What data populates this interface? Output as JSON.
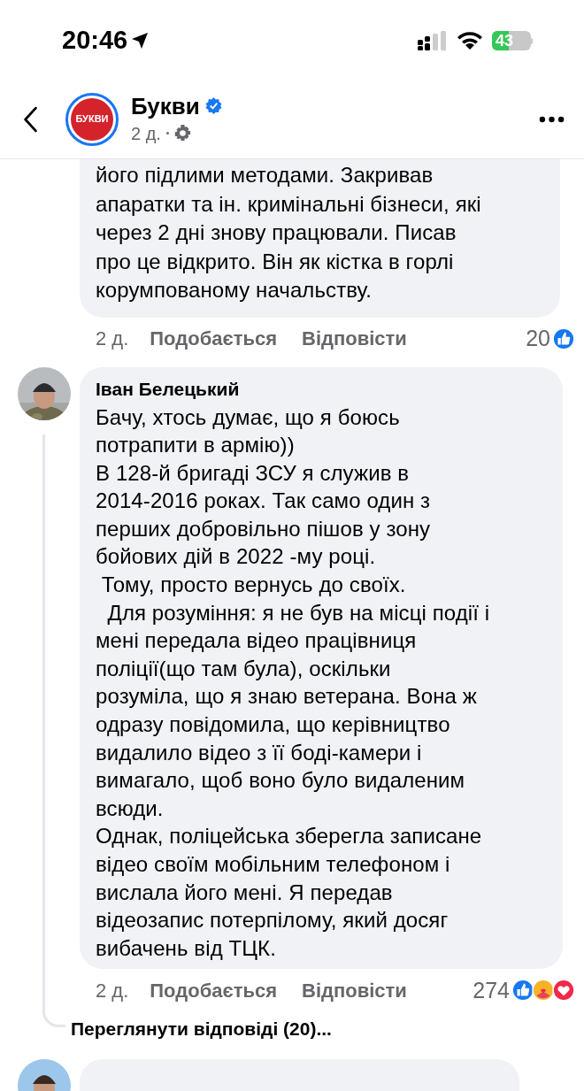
{
  "status_bar": {
    "time": "20:46",
    "battery": "43"
  },
  "header": {
    "page_name": "Букви",
    "logo_text": "БУКВИ",
    "verified": true,
    "time": "2 д."
  },
  "comments": [
    {
      "kind": "continued",
      "text": "його підлими методами. Закривав\nапаратки та ін. кримінальні бізнеси, які\nчерез 2 дні знову працювали. Писав\nпро це відкрито. Він як кістка в горлі\nкорумпованому начальству.",
      "time": "2 д.",
      "like": "Подобається",
      "reply": "Відповісти",
      "reactions_count": "20",
      "reactions": [
        {
          "kind": "like"
        }
      ]
    },
    {
      "kind": "full",
      "author": "Іван Белецький",
      "text": "Бачу, хтось думає, що я боюсь\nпотрапити в армію))\nВ 128-й бригаді ЗСУ я служив в\n2014-2016 роках. Так само один з\nперших добровільно пішов у зону\nбойових дій в 2022 -му році.\n Тому, просто вернусь до своїх.\n  Для розуміння: я не був на місці події і\nмені передала відео працівниця\nполіції(що там була), оскільки\nрозуміла, що я знаю ветерана. Вона ж\nодразу повідомила, що керівництво\nвидалило відео з її боді-камери і\nвимагало, щоб воно було видаленим\nвсюди.\nОднак, поліцейська зберегла записане\nвідео своїм мобільним телефоном і\nвислала його мені. Я передав\nвідеозапис потерпілому, який досяг\nвибачень від ТЦК.",
      "time": "2 д.",
      "like": "Подобається",
      "reply": "Відповісти",
      "reactions_count": "274",
      "reactions": [
        {
          "kind": "like"
        },
        {
          "kind": "care"
        },
        {
          "kind": "love"
        }
      ],
      "view_replies": "Переглянути відповіді (20)..."
    },
    {
      "kind": "cut"
    }
  ]
}
